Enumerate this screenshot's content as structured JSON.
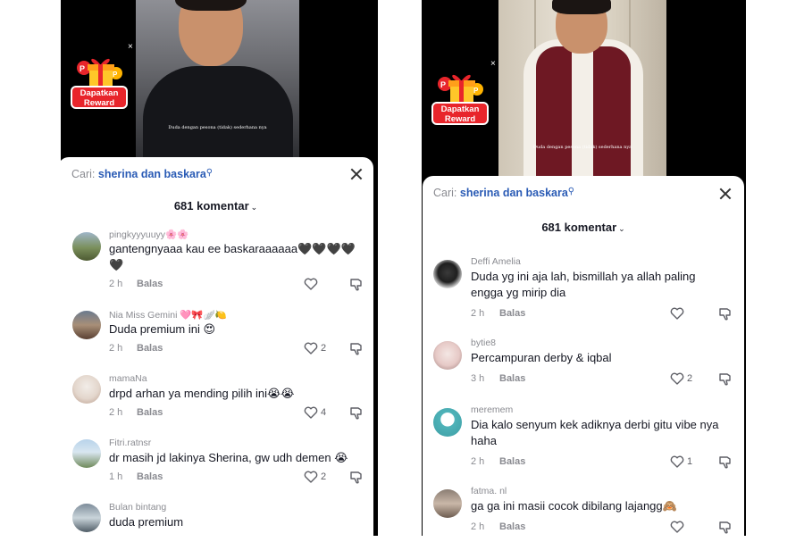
{
  "left": {
    "subtitle": "Duda dengan pesona (tidak) sederhana nya",
    "reward_label_1": "Dapatkan",
    "reward_label_2": "Reward",
    "reward_close": "×",
    "search": {
      "prefix": "Cari:",
      "query": "sherina dan baskara"
    },
    "comment_count": "681 komentar",
    "comments": [
      {
        "user": "pingkyyyuuyy🌸🌸",
        "text": "gantengnyaaa kau ee baskaraaaaaa🖤🖤🖤🖤🖤",
        "time": "2 h",
        "reply": "Balas",
        "likes": ""
      },
      {
        "user": "Nia Miss Gemini 🩷🎀🪽🍋",
        "text": "Duda premium ini 😍",
        "time": "2 h",
        "reply": "Balas",
        "likes": "2"
      },
      {
        "user": "mamaNa",
        "text": "drpd arhan ya mending pilih ini😭😭",
        "time": "2 h",
        "reply": "Balas",
        "likes": "4"
      },
      {
        "user": "Fitri.ratnsr",
        "text": "dr masih jd lakinya Sherina, gw udh demen 😭",
        "time": "1 h",
        "reply": "Balas",
        "likes": "2"
      },
      {
        "user": "Bulan bintang",
        "text": "duda premium",
        "time": "",
        "reply": "",
        "likes": ""
      }
    ]
  },
  "right": {
    "subtitle": "Duda dengan pesona (tidak) sederhana nya",
    "reward_label_1": "Dapatkan",
    "reward_label_2": "Reward",
    "reward_close": "×",
    "search": {
      "prefix": "Cari:",
      "query": "sherina dan baskara"
    },
    "comment_count": "681 komentar",
    "comments": [
      {
        "user": "Deffi Amelia",
        "text": "Duda yg ini aja lah, bismillah ya allah paling engga yg mirip dia",
        "time": "2 h",
        "reply": "Balas",
        "likes": ""
      },
      {
        "user": "bytie8",
        "text": "Percampuran derby & iqbal",
        "time": "3 h",
        "reply": "Balas",
        "likes": "2"
      },
      {
        "user": "meremem",
        "text": "Dia kalo senyum kek adiknya derbi gitu vibe nya haha",
        "time": "2 h",
        "reply": "Balas",
        "likes": "1"
      },
      {
        "user": "fatma. nl",
        "text": "ga ga ini masii cocok dibilang lajangg🙈",
        "time": "2 h",
        "reply": "Balas",
        "likes": ""
      }
    ]
  },
  "colors": {
    "accent_blue": "#2a5bb5",
    "reward_red": "#e8252b",
    "muted": "#8a8b91"
  },
  "icons": [
    "heart-icon",
    "thumbs-down-icon",
    "search-icon",
    "close-icon",
    "chevron-down-icon",
    "gift-icon"
  ]
}
